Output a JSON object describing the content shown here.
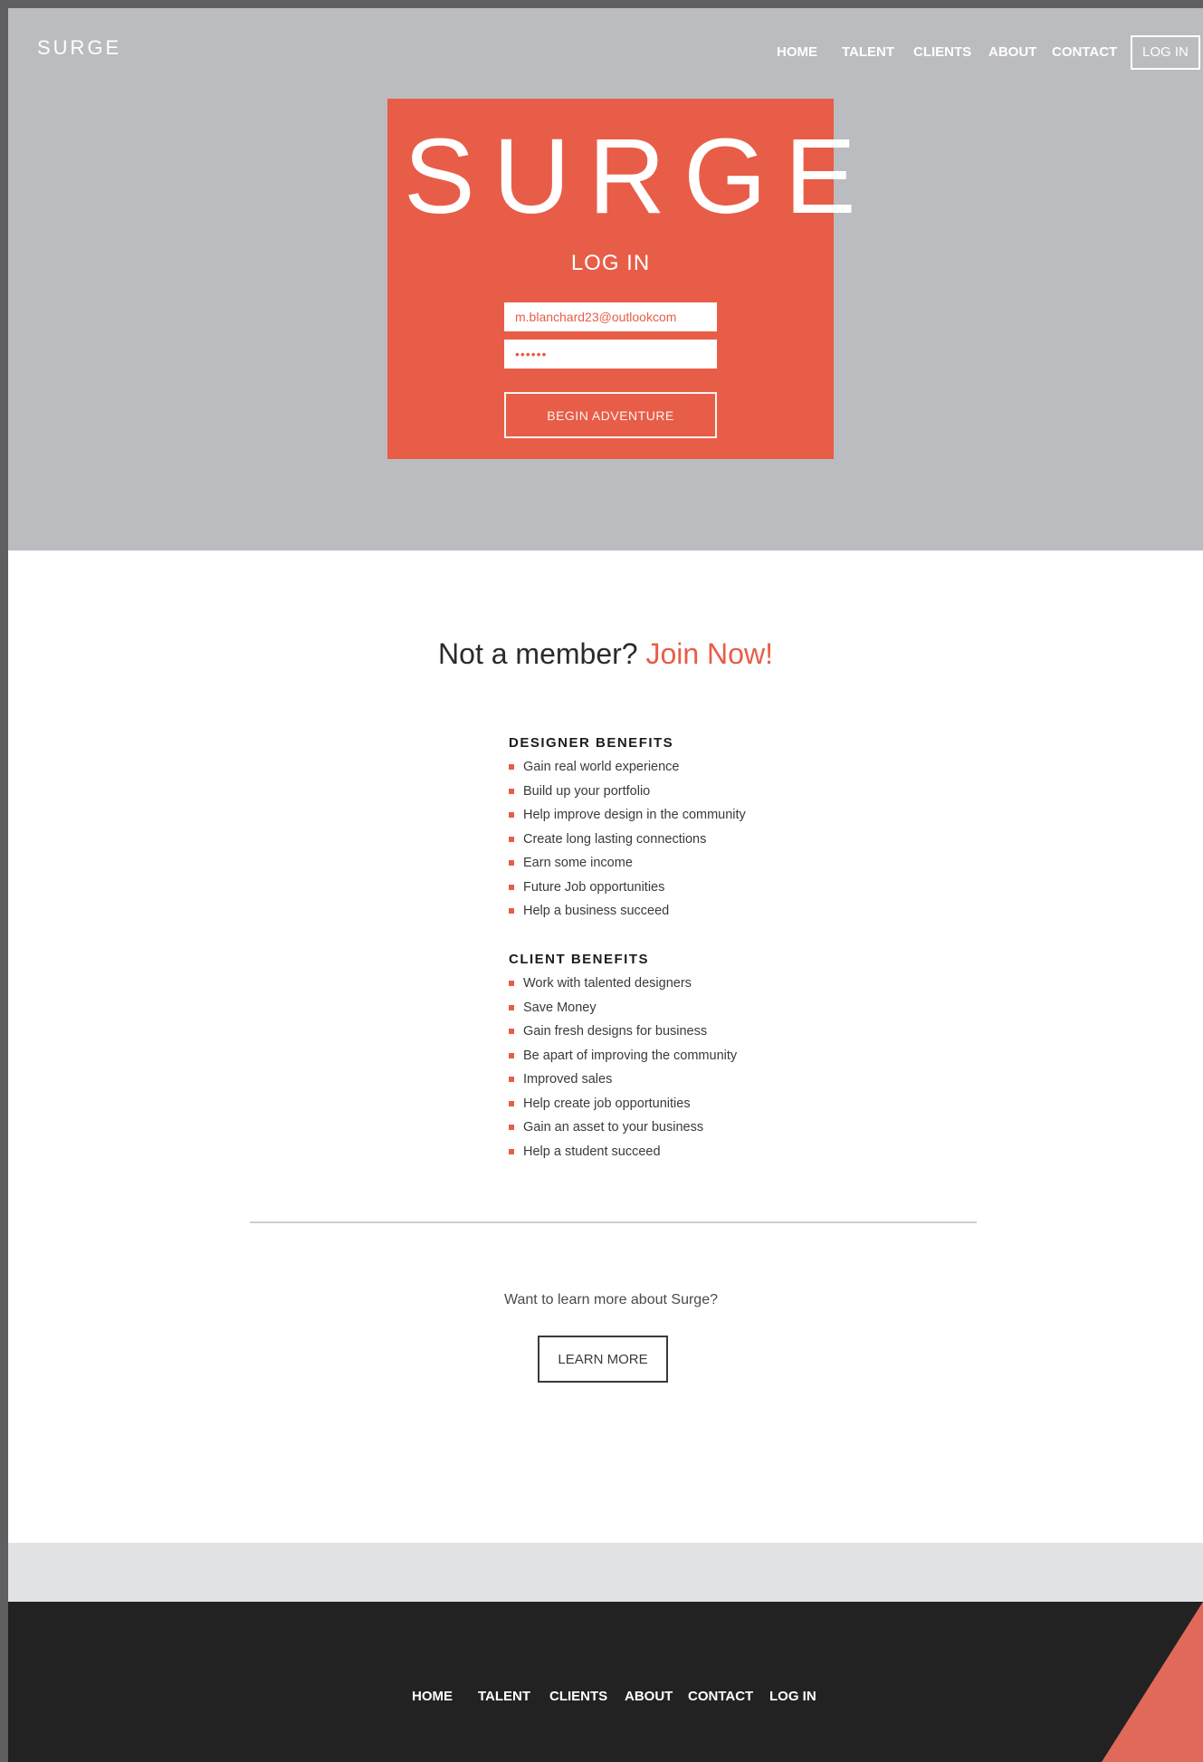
{
  "header": {
    "brand": "SURGE",
    "nav": [
      "HOME",
      "TALENT",
      "CLIENTS",
      "ABOUT",
      "CONTACT"
    ],
    "login": "LOG IN"
  },
  "login_card": {
    "logo": "SURGE",
    "title": "LOG IN",
    "email_value": "m.blanchard23@outlookcom",
    "password_value": "••••••",
    "submit_label": "BEGIN ADVENTURE"
  },
  "membership": {
    "prompt": "Not a member?",
    "join_link": "Join Now!"
  },
  "designer_benefits": {
    "heading": "DESIGNER BENEFITS",
    "items": [
      "Gain real world experience",
      "Build up your portfolio",
      "Help improve design in the community",
      "Create long lasting connections",
      "Earn some income",
      "Future Job opportunities",
      "Help a business succeed"
    ]
  },
  "client_benefits": {
    "heading": "CLIENT BENEFITS",
    "items": [
      "Work with talented designers",
      "Save Money",
      "Gain fresh designs for business",
      "Be apart of improving the community",
      "Improved sales",
      "Help create job opportunities",
      "Gain an asset to your business",
      "Help a student succeed"
    ]
  },
  "learn_more": {
    "prompt": "Want to learn more about Surge?",
    "button_label": "LEARN MORE"
  },
  "footer": {
    "nav": [
      "HOME",
      "TALENT",
      "CLIENTS",
      "ABOUT",
      "CONTACT",
      "LOG IN"
    ]
  },
  "colors": {
    "accent": "#e85d47",
    "hero_bg": "#bbbcbf",
    "footer_bg": "#222222"
  }
}
